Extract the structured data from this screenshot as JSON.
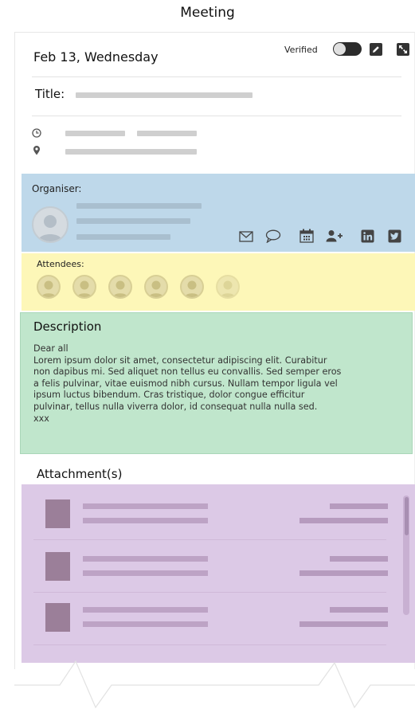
{
  "screen": {
    "title": "Meeting"
  },
  "header": {
    "date": "Feb 13, Wednesday",
    "verified_label": "Verified",
    "verified_on": true,
    "edit_icon": "edit-icon",
    "expand_icon": "expand-icon"
  },
  "meeting": {
    "title_label": "Title:",
    "time_icon": "clock-icon",
    "location_icon": "location-pin-icon"
  },
  "organiser": {
    "label": "Organiser:",
    "actions": [
      "mail-icon",
      "chat-icon",
      "calendar-icon",
      "add-contact-icon",
      "linkedin-icon",
      "twitter-icon"
    ]
  },
  "attendees": {
    "label": "Attendees:",
    "count": 6
  },
  "description": {
    "title": "Description",
    "body": "Dear all\nLorem ipsum dolor sit amet, consectetur adipiscing elit. Curabitur\nnon dapibus mi. Sed aliquet non tellus eu convallis. Sed semper eros\na felis pulvinar, vitae euismod nibh cursus. Nullam tempor ligula vel\nipsum luctus bibendum. Cras tristique, dolor congue efficitur\npulvinar, tellus nulla viverra dolor, id consequat nulla nulla sed.\nxxx"
  },
  "attachments": {
    "title": "Attachment(s)",
    "count": 3
  },
  "colors": {
    "organiser_bg": "#bed8ea",
    "attendees_bg": "#fdf7b8",
    "description_bg": "#c0e6cc",
    "attachments_bg": "#dcc9e6"
  }
}
